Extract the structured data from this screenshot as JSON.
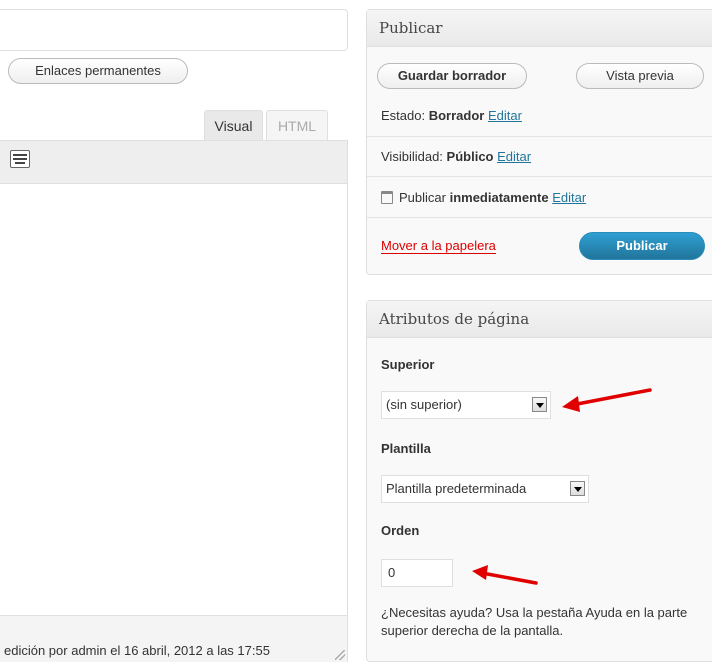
{
  "editor": {
    "permalink_button": "Enlaces permanentes",
    "tabs": [
      {
        "label": "Visual",
        "active": true
      },
      {
        "label": "HTML",
        "active": false
      }
    ],
    "status_text": "edición por admin el 16 abril, 2012 a las 17:55"
  },
  "publish": {
    "title": "Publicar",
    "save_draft": "Guardar borrador",
    "preview": "Vista previa",
    "status_label": "Estado:",
    "status_value": "Borrador",
    "visibility_label": "Visibilidad:",
    "visibility_value": "Público",
    "schedule_label": "Publicar",
    "schedule_value": "inmediatamente",
    "edit_link": "Editar",
    "trash_link": "Mover a la papelera",
    "publish_button": "Publicar"
  },
  "attributes": {
    "title": "Atributos de página",
    "parent_label": "Superior",
    "parent_value": "(sin superior)",
    "template_label": "Plantilla",
    "template_value": "Plantilla predeterminada",
    "order_label": "Orden",
    "order_value": "0",
    "help_text": "¿Necesitas ayuda? Usa la pestaña Ayuda en la parte superior derecha de la pantalla."
  },
  "colors": {
    "link": "#21759b",
    "trash": "#dd0000",
    "publish_button": "#21759b",
    "annotation_arrow": "#e00000"
  },
  "icons": [
    "keyboard-icon",
    "calendar-icon",
    "select-arrow-icon",
    "resize-grip-icon",
    "annotation-arrow-icon"
  ]
}
